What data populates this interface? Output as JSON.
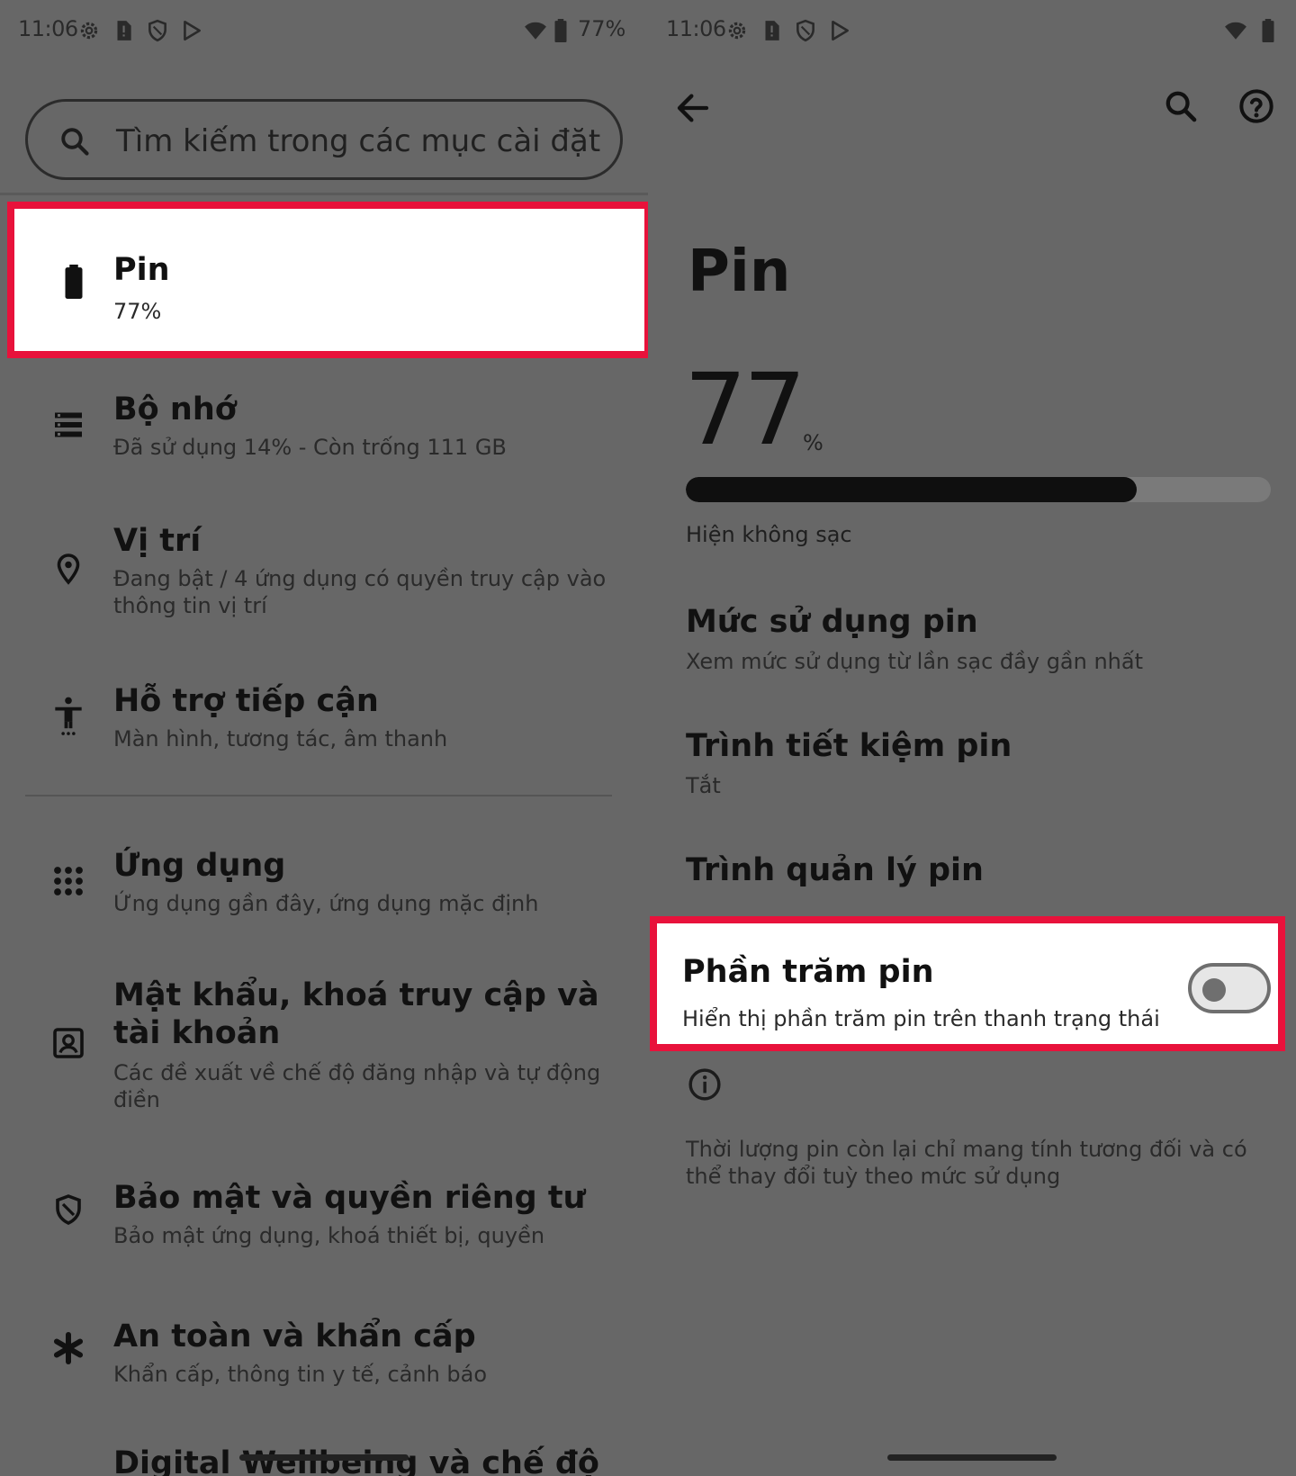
{
  "left": {
    "status": {
      "time": "11:06",
      "battery_pct": "77%"
    },
    "search": {
      "placeholder": "Tìm kiếm trong các mục cài đặt"
    },
    "items": [
      {
        "icon": "battery-icon",
        "title": "Pin",
        "sub": "77%"
      },
      {
        "icon": "storage-icon",
        "title": "Bộ nhớ",
        "sub": "Đã sử dụng 14% - Còn trống 111 GB"
      },
      {
        "icon": "location-icon",
        "title": "Vị trí",
        "sub": "Đang bật / 4 ứng dụng có quyền truy cập vào thông tin vị trí"
      },
      {
        "icon": "accessibility-icon",
        "title": "Hỗ trợ tiếp cận",
        "sub": "Màn hình, tương tác, âm thanh"
      },
      {
        "icon": "apps-icon",
        "title": "Ứng dụng",
        "sub": "Ứng dụng gần đây, ứng dụng mặc định"
      },
      {
        "icon": "account-icon",
        "title": "Mật khẩu, khoá truy cập và tài khoản",
        "sub": "Các đề xuất về chế độ đăng nhập và tự động điền"
      },
      {
        "icon": "shield-icon",
        "title": "Bảo mật và quyền riêng tư",
        "sub": "Bảo mật ứng dụng, khoá thiết bị, quyền"
      },
      {
        "icon": "asterisk-icon",
        "title": "An toàn và khẩn cấp",
        "sub": "Khẩn cấp, thông tin y tế, cảnh báo"
      },
      {
        "title": "Digital Wellbeing và chế độ"
      }
    ]
  },
  "right": {
    "status": {
      "time": "11:06"
    },
    "page_title": "Pin",
    "battery_level": "77",
    "percent_sign": "%",
    "battery_fraction": 0.77,
    "charge_status": "Hiện không sạc",
    "items": [
      {
        "title": "Mức sử dụng pin",
        "sub": "Xem mức sử dụng từ lần sạc đầy gần nhất"
      },
      {
        "title": "Trình tiết kiệm pin",
        "sub": "Tắt"
      },
      {
        "title": "Trình quản lý pin"
      }
    ],
    "percent_toggle": {
      "title": "Phần trăm pin",
      "sub": "Hiển thị phần trăm pin trên thanh trạng thái",
      "state": "off"
    },
    "note": "Thời lượng pin còn lại chỉ mang tính tương đối và có thể thay đổi tuỳ theo mức sử dụng"
  },
  "colors": {
    "background": "#676767",
    "highlight_border": "#e8123b",
    "text": "#111111"
  }
}
